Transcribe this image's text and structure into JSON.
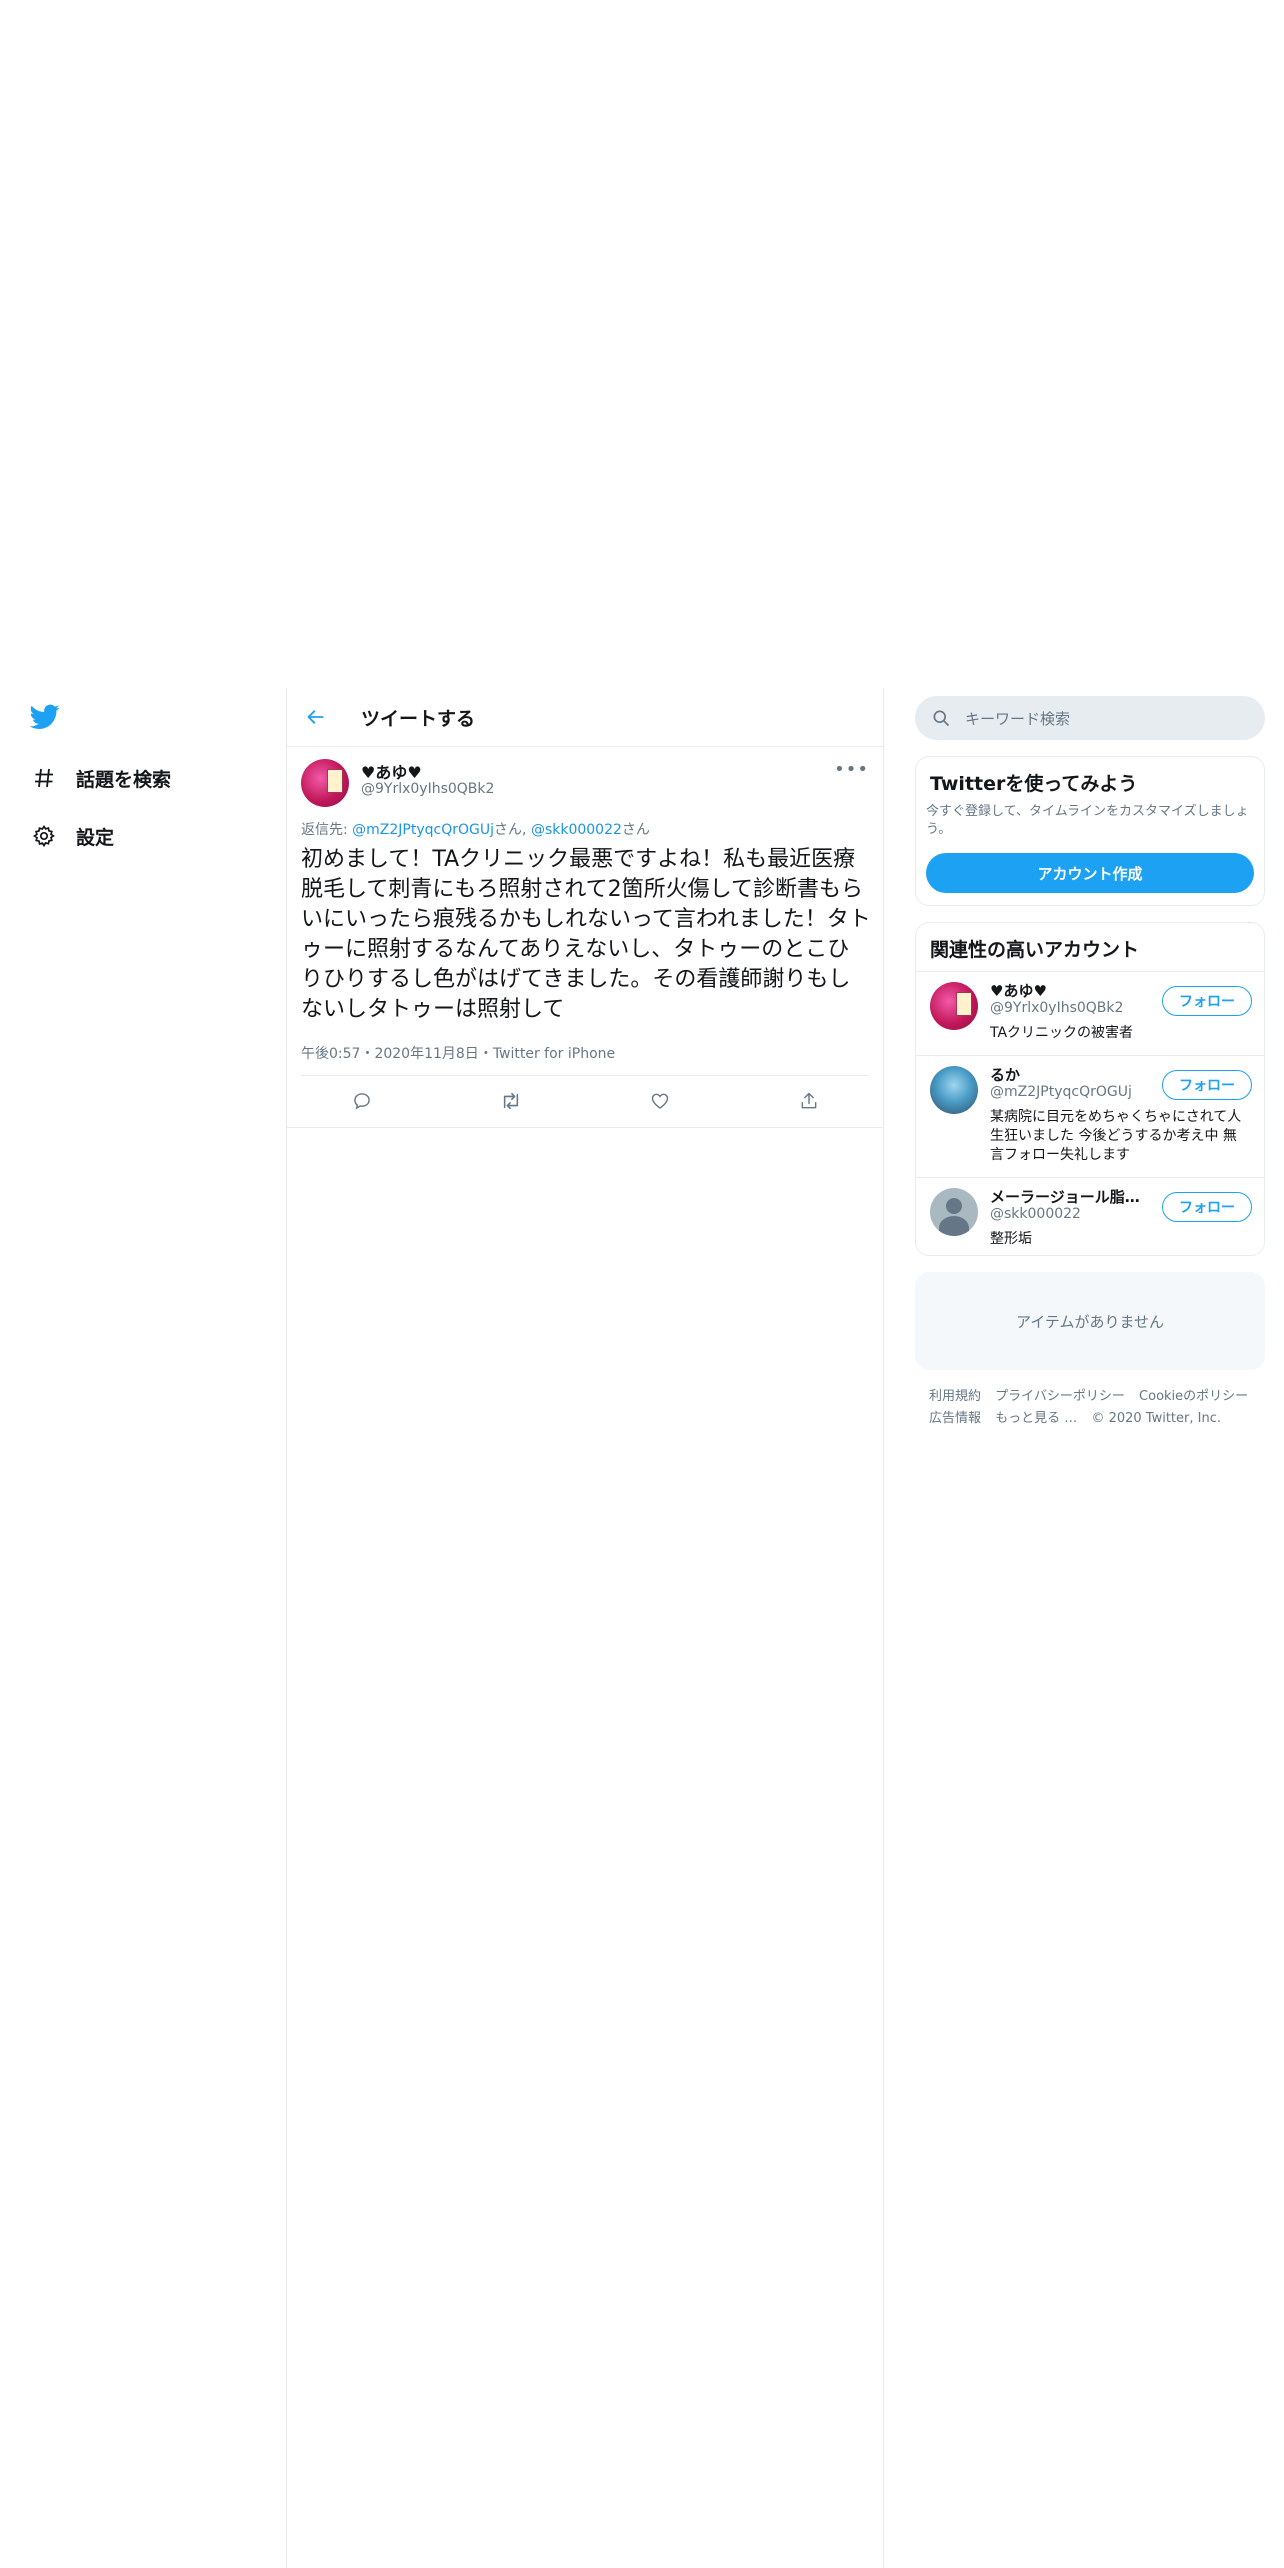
{
  "nav": {
    "logo_icon": "twitter-bird-icon",
    "items": [
      {
        "label": "話題を検索",
        "icon": "hashtag-icon"
      },
      {
        "label": "設定",
        "icon": "gear-icon"
      }
    ]
  },
  "header": {
    "title": "ツイートする",
    "back_icon": "arrow-left-icon"
  },
  "tweet": {
    "name": "♥あゆ♥",
    "handle": "@9Yrlx0yIhs0QBk2",
    "reply_prefix": "返信先: ",
    "reply_to_1": "@mZ2JPtyqcQrOGUj",
    "reply_sep": "さん, ",
    "reply_to_2": "@skk000022",
    "reply_suffix": "さん",
    "text": "初めまして！TAクリニック最悪ですよね！私も最近医療脱毛して刺青にもろ照射されて2箇所火傷して診断書もらいにいったら痕残るかもしれないって言われました！タトゥーに照射するなんてありえないし、タトゥーのとこひりひりするし色がはげてきました。その看護師謝りもしないしタトゥーは照射して",
    "time": "午後0:57",
    "dot1": "・",
    "date": "2020年11月8日",
    "dot2": "・",
    "source": "Twitter for iPhone",
    "more": "•••"
  },
  "search": {
    "placeholder": "キーワード検索"
  },
  "signup": {
    "title": "Twitterを使ってみよう",
    "desc": "今すぐ登録して、タイムラインをカスタマイズしましょう。",
    "button": "アカウント作成"
  },
  "related": {
    "title": "関連性の高いアカウント",
    "follow_label": "フォロー",
    "users": [
      {
        "name": "♥あゆ♥",
        "handle": "@9Yrlx0yIhs0QBk2",
        "bio": "TAクリニックの被害者"
      },
      {
        "name": "るか",
        "handle": "@mZ2JPtyqcQrOGUj",
        "bio": "某病院に目元をめちゃくちゃにされて人生狂いました 今後どうするか考え中 無言フォロー失礼します"
      },
      {
        "name": "メーラージョール脂肪吸引…",
        "handle": "@skk000022",
        "bio": "整形垢"
      }
    ]
  },
  "trends": {
    "empty": "アイテムがありません"
  },
  "footer": {
    "links": [
      "利用規約",
      "プライバシーポリシー",
      "Cookieのポリシー",
      "広告情報",
      "もっと見る …"
    ],
    "copyright": "© 2020 Twitter, Inc."
  },
  "colors": {
    "accent": "#1da1f2",
    "secondary_text": "#657786",
    "border": "#e6ecf0"
  }
}
